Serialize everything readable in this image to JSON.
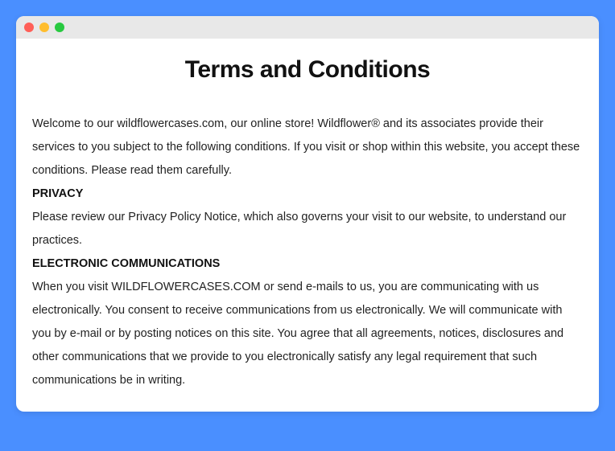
{
  "title": "Terms and Conditions",
  "intro": "Welcome to our wildflowercases.com, our online store! Wildflower® and its associates provide their services to you subject to the following conditions. If you visit or shop within this website, you accept these conditions. Please read them carefully.",
  "sections": [
    {
      "heading": "PRIVACY",
      "body": "Please review our Privacy Policy Notice, which also governs your visit to our website, to understand our practices."
    },
    {
      "heading": "ELECTRONIC COMMUNICATIONS",
      "body": "When you visit WILDFLOWERCASES.COM or send e-mails to us, you are communicating with us electronically. You consent to receive communications from us electronically. We will communicate with you by e-mail or by posting notices on this site. You agree that all agreements, notices, disclosures and other communications that we provide to you electronically satisfy any legal requirement that such communications be in writing."
    }
  ]
}
